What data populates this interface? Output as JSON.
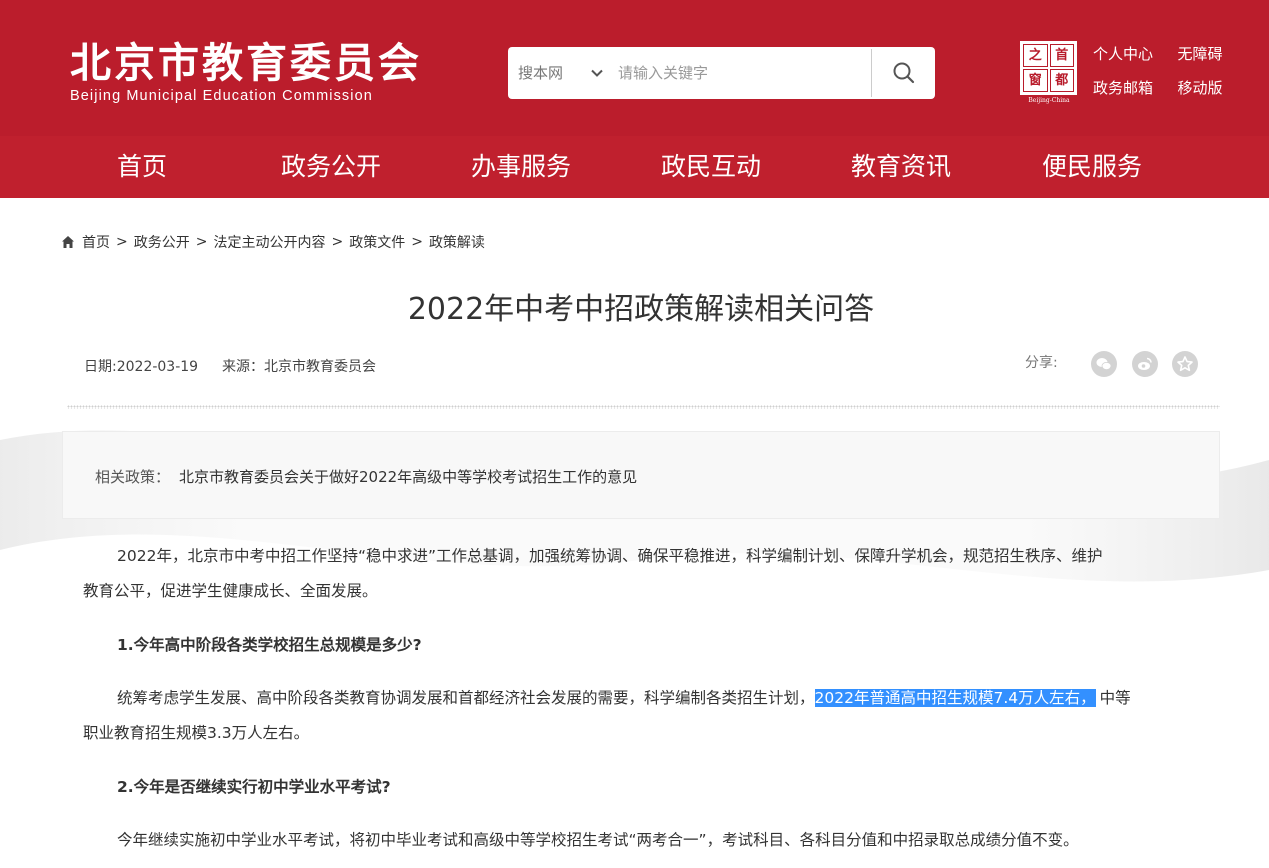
{
  "site": {
    "name_cn": "北京市教育委员会",
    "name_en": "Beijing Municipal Education Commission",
    "brand_color": "#bb1d2c"
  },
  "search": {
    "scope": "搜本网",
    "placeholder": "请输入关键字"
  },
  "emblem": {
    "chars": [
      "之",
      "首",
      "窗",
      "都"
    ],
    "caption": "Beijing-China"
  },
  "top_links": [
    "个人中心",
    "无障碍",
    "政务邮箱",
    "移动版"
  ],
  "nav": [
    "首页",
    "政务公开",
    "办事服务",
    "政民互动",
    "教育资讯",
    "便民服务"
  ],
  "breadcrumb": [
    "首页",
    "政务公开",
    "法定主动公开内容",
    "政策文件",
    "政策解读"
  ],
  "article": {
    "title": "2022年中考中招政策解读相关问答",
    "date": "日期:2022-03-19",
    "source": "来源：北京市教育委员会",
    "share_label": "分享:",
    "share_icons": [
      "wechat-icon",
      "weibo-icon",
      "favorite-icon"
    ]
  },
  "related": {
    "label": "相关政策：",
    "link": "北京市教育委员会关于做好2022年高级中等学校考试招生工作的意见"
  },
  "body": {
    "intro_line1": "2022年，北京市中考中招工作坚持“稳中求进”工作总基调，加强统筹协调、确保平稳推进，科学编制计划、保障升学机会，规范招生秩序、维护",
    "intro_line2": "教育公平，促进学生健康成长、全面发展。",
    "q1": "1.今年高中阶段各类学校招生总规模是多少?",
    "a1_before": "统筹考虑学生发展、高中阶段各类教育协调发展和首都经济社会发展的需要，科学编制各类招生计划，",
    "a1_highlight": "2022年普通高中招生规模7.4万人左右，",
    "a1_after": "中等",
    "a1_line2": "职业教育招生规模3.3万人左右。",
    "q2": "2.今年是否继续实行初中学业水平考试?",
    "a2_line1": "今年继续实施初中学业水平考试，将初中毕业考试和高级中等学校招生考试“两考合一”，考试科目、各科目分值和中招录取总成绩分值不变。"
  }
}
